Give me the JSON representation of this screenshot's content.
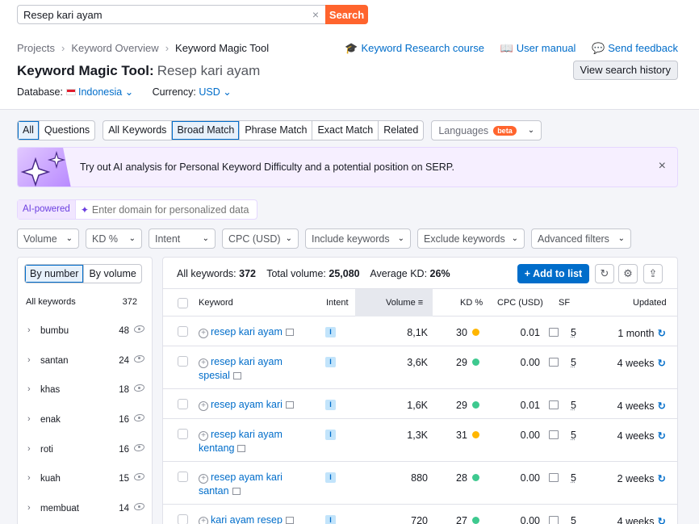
{
  "search": {
    "value": "Resep kari ayam",
    "button": "Search",
    "clear": "×"
  },
  "breadcrumb": [
    "Projects",
    "Keyword Overview",
    "Keyword Magic Tool"
  ],
  "breadcrumb_sep": "›",
  "header_links": [
    {
      "icon": "graduation-cap-icon",
      "label": "Keyword Research course"
    },
    {
      "icon": "book-icon",
      "label": "User manual"
    },
    {
      "icon": "chat-icon",
      "label": "Send feedback"
    }
  ],
  "title": {
    "tool": "Keyword Magic Tool:",
    "keyword": "Resep kari ayam"
  },
  "view_history": "View search history",
  "database": {
    "label": "Database:",
    "value": "Indonesia"
  },
  "currency": {
    "label": "Currency:",
    "value": "USD"
  },
  "tabs": {
    "group1": [
      "All",
      "Questions"
    ],
    "group2": [
      "All Keywords",
      "Broad Match",
      "Phrase Match",
      "Exact Match",
      "Related"
    ],
    "languages": "Languages",
    "beta": "beta"
  },
  "banner": {
    "prefix": "Try out ",
    "highlight": "AI analysis",
    "suffix": " for Personal Keyword Difficulty and a potential position on SERP.",
    "close": "×"
  },
  "ai": {
    "label": "AI-powered",
    "placeholder": "Enter domain for personalized data"
  },
  "filters": [
    "Volume",
    "KD %",
    "Intent",
    "CPC (USD)",
    "Include keywords",
    "Exclude keywords",
    "Advanced filters"
  ],
  "left": {
    "seg": [
      "By number",
      "By volume"
    ],
    "head_label": "All keywords",
    "head_count": "372",
    "items": [
      {
        "name": "bumbu",
        "count": "48"
      },
      {
        "name": "santan",
        "count": "24"
      },
      {
        "name": "khas",
        "count": "18"
      },
      {
        "name": "enak",
        "count": "16"
      },
      {
        "name": "roti",
        "count": "16"
      },
      {
        "name": "kuah",
        "count": "15"
      },
      {
        "name": "membuat",
        "count": "14"
      }
    ]
  },
  "summary": {
    "all_label": "All keywords:",
    "all_value": "372",
    "vol_label": "Total volume:",
    "vol_value": "25,080",
    "kd_label": "Average KD:",
    "kd_value": "26%"
  },
  "add_to_list": "+  Add to list",
  "columns": [
    "Keyword",
    "Intent",
    "Volume",
    "KD %",
    "CPC (USD)",
    "SF",
    "Updated"
  ],
  "rows": [
    {
      "keyword": "resep kari ayam",
      "intent": "I",
      "volume": "8,1K",
      "kd": "30",
      "kd_color": "#ffb600",
      "cpc": "0.01",
      "sf": "5",
      "updated": "1 month"
    },
    {
      "keyword": "resep kari ayam spesial",
      "intent": "I",
      "volume": "3,6K",
      "kd": "29",
      "kd_color": "#3ec98f",
      "cpc": "0.00",
      "sf": "5",
      "updated": "4 weeks"
    },
    {
      "keyword": "resep ayam kari",
      "intent": "I",
      "volume": "1,6K",
      "kd": "29",
      "kd_color": "#3ec98f",
      "cpc": "0.01",
      "sf": "5",
      "updated": "4 weeks"
    },
    {
      "keyword": "resep kari ayam kentang",
      "intent": "I",
      "volume": "1,3K",
      "kd": "31",
      "kd_color": "#ffb600",
      "cpc": "0.00",
      "sf": "5",
      "updated": "4 weeks"
    },
    {
      "keyword": "resep ayam kari santan",
      "intent": "I",
      "volume": "880",
      "kd": "28",
      "kd_color": "#3ec98f",
      "cpc": "0.00",
      "sf": "5",
      "updated": "2 weeks"
    },
    {
      "keyword": "kari ayam resep",
      "intent": "I",
      "volume": "720",
      "kd": "27",
      "kd_color": "#3ec98f",
      "cpc": "0.00",
      "sf": "5",
      "updated": "4 weeks"
    }
  ]
}
